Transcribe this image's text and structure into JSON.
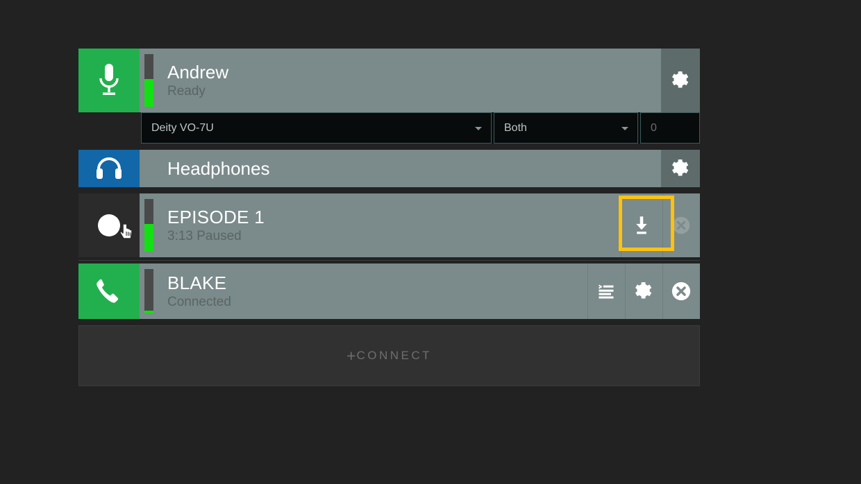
{
  "app": {
    "background": "#222222",
    "row_background": "#7b8a8a",
    "accent_green": "#22b04e",
    "accent_blue": "#1167a8",
    "highlight_color": "#ffc20e",
    "meter_green": "#13e013"
  },
  "channels": [
    {
      "id": "mic",
      "icon": "microphone-icon",
      "icon_bg": "#22b04e",
      "title": "Andrew",
      "status": "Ready",
      "meter_level": 52,
      "buttons": [
        "gear-icon"
      ]
    },
    {
      "id": "headphones",
      "icon": "headphones-icon",
      "icon_bg": "#1167a8",
      "title": "Headphones",
      "status": "",
      "meter_level": 0,
      "buttons": [
        "gear-icon"
      ]
    },
    {
      "id": "episode",
      "icon": "record-button",
      "icon_bg": "#2b2b2b",
      "title": "EPISODE 1",
      "status": "3:13 Paused",
      "meter_level": 52,
      "buttons": [
        "download-icon",
        "close-icon"
      ]
    },
    {
      "id": "blake",
      "icon": "phone-icon",
      "icon_bg": "#22b04e",
      "title": "BLAKE",
      "status": "Connected",
      "meter_level": 7,
      "buttons": [
        "log-icon",
        "gear-icon",
        "close-icon"
      ]
    }
  ],
  "device_selects": {
    "device": {
      "value": "Deity VO-7U",
      "caret": "chevron-down-icon"
    },
    "channel": {
      "value": "Both",
      "caret": "chevron-down-icon"
    },
    "gain": {
      "value": "0"
    }
  },
  "connect_bar": {
    "plus": "+",
    "label": "CONNECT"
  },
  "cursor": {
    "type": "pointing-hand-cursor"
  }
}
